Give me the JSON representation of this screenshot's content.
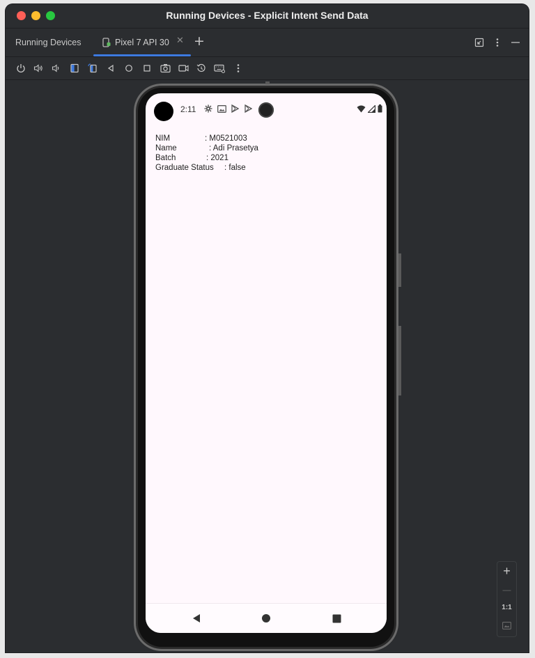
{
  "window": {
    "title": "Running Devices - Explicit Intent Send Data"
  },
  "tabs": {
    "panel_title": "Running Devices",
    "active_tab": "Pixel 7 API 30",
    "close_glyph": "✕",
    "add_glyph": "+"
  },
  "statusbar": {
    "time": "2:11"
  },
  "student": {
    "nim_label": "NIM",
    "nim_value": ": M0521003",
    "name_label": "Name",
    "name_value": ": Adi Prasetya",
    "batch_label": "Batch",
    "batch_value": ": 2021",
    "status_label": "Graduate Status",
    "status_value": ": false"
  },
  "zoom": {
    "plus": "+",
    "minus": "—",
    "one_to_one": "1:1"
  },
  "colors": {
    "accent": "#3d7ae0",
    "ide_bg": "#2b2d30",
    "screen_bg": "#fff8fd"
  }
}
